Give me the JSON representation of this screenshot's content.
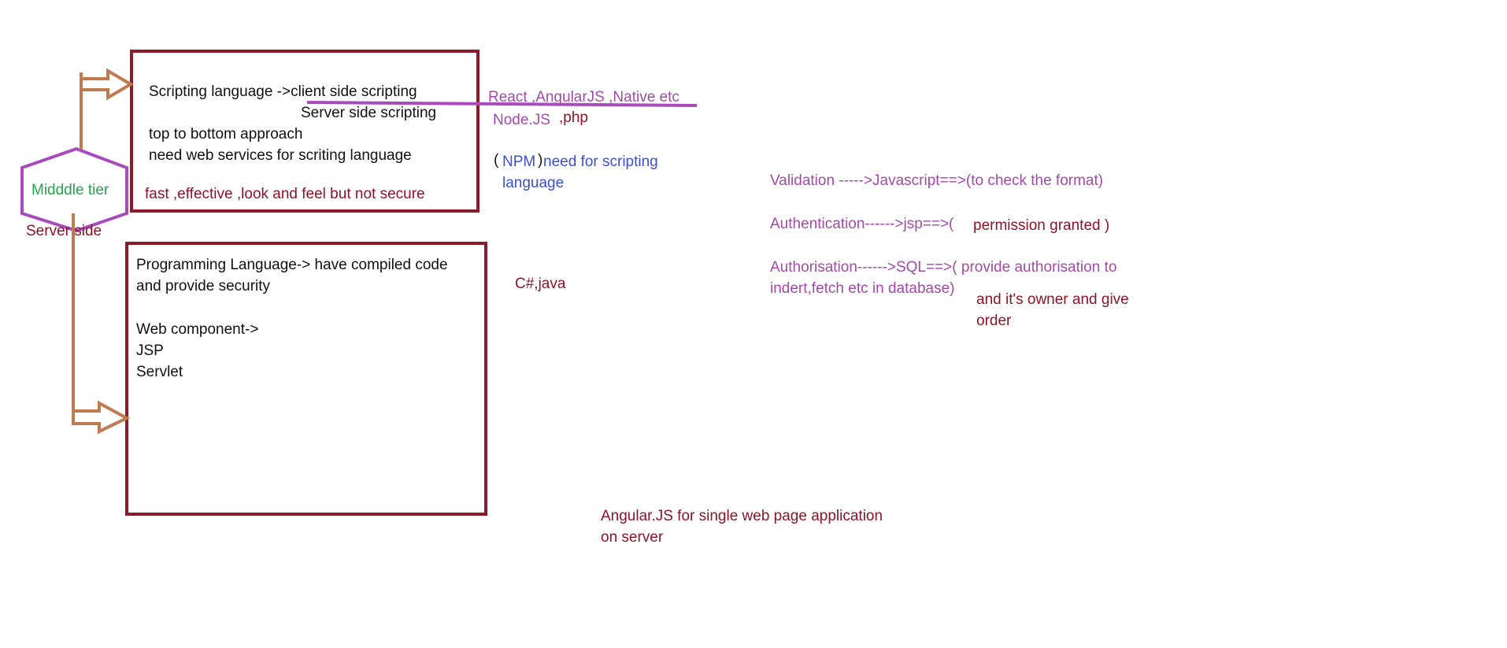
{
  "colors": {
    "box_border": "#8b1a2b",
    "arrow": "#c07a4f",
    "hexagon": "#a94bbd",
    "strike": "#a94bbd",
    "black_text": "#111111",
    "maroon_text": "#8b1428",
    "purple_text": "#a24aa6",
    "blue_text": "#3a4fd0",
    "green_text": "#22a84a"
  },
  "middle": {
    "hex_label": "Midddle tier",
    "server_side": "Server side"
  },
  "scripting_box": {
    "line1": "Scripting language ->client side scripting",
    "line2": "Server side scripting",
    "line3": "top to bottom approach",
    "line4": "need web services for scriting language",
    "line5": "fast ,effective ,look and feel but not secure"
  },
  "programming_box": {
    "line1": "Programming Language-> have compiled code",
    "line2": "and provide security",
    "line3": "Web component->",
    "line4": "JSP",
    "line5": "Servlet"
  },
  "notes": {
    "frameworks": "React ,AngularJS ,Native etc",
    "nodejs": "Node.JS",
    "php": ",php",
    "paren_open": "(",
    "npm": "NPM",
    "paren_close": ")",
    "npm_need_line1": "need for scripting",
    "npm_need_line2": "language",
    "csharp_java": "C#,java",
    "angular_line1": "Angular.JS for single web page application",
    "angular_line2": "on server"
  },
  "security": {
    "validation": "Validation ----->Javascript==>(to check the format)",
    "authentication": "Authentication------>jsp==>(",
    "permission": "permission granted )",
    "authorisation_line1": "Authorisation------>SQL==>( provide  authorisation to",
    "authorisation_line2": "indert,fetch etc in database)",
    "owner_line1": "and it's owner and give",
    "owner_line2": "order"
  }
}
